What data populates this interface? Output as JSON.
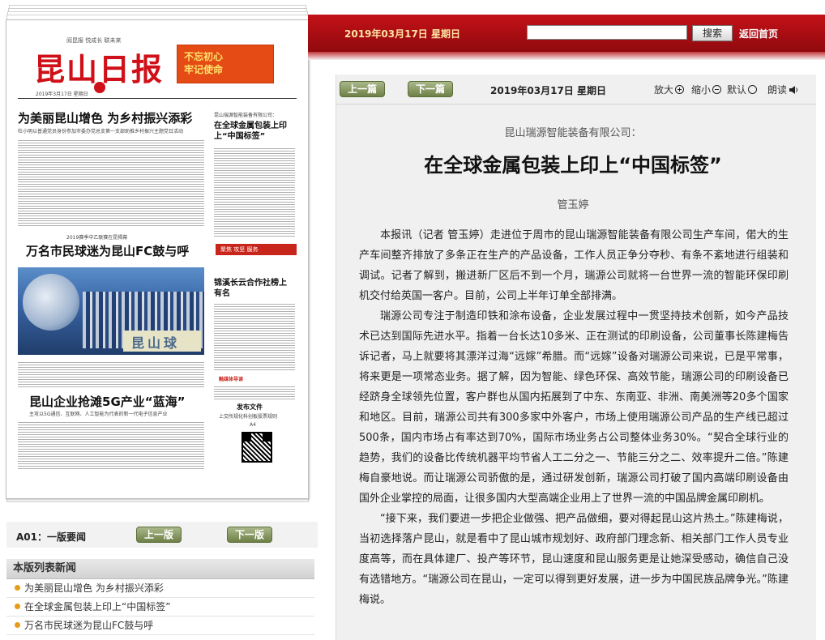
{
  "paper": {
    "mast_top": "阅昆报 悦成长 联未来",
    "name": "昆山日报",
    "mast_date": "2019年3月17日 星期日",
    "slogan": "不忘初心\n牢记使命",
    "lead_headline": "为美丽昆山增色 为乡村振兴添彩",
    "lead_sub": "杜小明以普通党员身份参加市委办党总支第一支部助推乡村振兴主题党日活动",
    "side_kicker": "昆山瑞源智能装备有限公司：",
    "side_headline": "在全球金属包装上印上“中国标签”",
    "football_kicker": "2019赛季中乙联赛在昆揭幕",
    "football_headline": "万名市民球迷为昆山FC鼓与呼",
    "coop_headline": "锦溪长云合作社榜上有名",
    "ad_text": "聚焦  攻坚  服务",
    "banner_text": "昆山球",
    "media_tag": "融媒体导读",
    "release_title": "发布文件",
    "release_sub": "上交所规化科创板股票规则",
    "release_page": "A4",
    "g5_headline": "昆山企业抢滩5G产业“蓝海”",
    "g5_sub": "主攻以5G通信、互联网、人工智能为代表的新一代电子信息产业"
  },
  "page_nav": {
    "label": "A01：一版要闻",
    "prev_label": "上一版",
    "next_label": "下一版"
  },
  "news_list": {
    "title": "本版列表新闻",
    "items": [
      "为美丽昆山增色 为乡村振兴添彩",
      "在全球金属包装上印上“中国标签”",
      "万名市民球迷为昆山FC鼓与呼"
    ]
  },
  "topbar": {
    "date": "2019年03月17日 星期日",
    "search_value": "",
    "search_button": "搜索",
    "home_link": "返回首页"
  },
  "article": {
    "prev_label": "上一篇",
    "next_label": "下一篇",
    "date": "2019年03月17日 星期日",
    "zoom_in": "放大",
    "zoom_out": "缩小",
    "default": "默认",
    "read_aloud": "朗读",
    "kicker": "昆山瑞源智能装备有限公司：",
    "title": "在全球金属包装上印上“中国标签”",
    "author": "管玉婷",
    "paragraphs": [
      "本报讯（记者 管玉婷）走进位于周市的昆山瑞源智能装备有限公司生产车间，偌大的生产车间整齐排放了多条正在生产的产品设备，工作人员正争分夺秒、有条不紊地进行组装和调试。记者了解到，搬进新厂区后不到一个月，瑞源公司就将一台世界一流的智能环保印刷机交付给英国一客户。目前，公司上半年订单全部排满。",
      "瑞源公司专注于制造印铁和涂布设备，企业发展过程中一贯坚持技术创新，如今产品技术已达到国际先进水平。指着一台长达10多米、正在测试的印刷设备，公司董事长陈建梅告诉记者，马上就要将其漂洋过海“远嫁”希腊。而“远嫁”设备对瑞源公司来说，已是平常事，将来更是一项常态业务。据了解，因为智能、绿色环保、高效节能，瑞源公司的印刷设备已经跻身全球领先位置，客户群也从国内拓展到了中东、东南亚、非洲、南美洲等20多个国家和地区。目前，瑞源公司共有300多家中外客户，市场上使用瑞源公司产品的生产线已超过500条，国内市场占有率达到70%，国际市场业务占公司整体业务30%。“契合全球行业的趋势，我们的设备比传统机器平均节省人工二分之一、节能三分之二、效率提升二倍。”陈建梅自豪地说。而让瑞源公司骄傲的是，通过研发创新，瑞源公司打破了国内高端印刷设备由国外企业掌控的局面，让很多国内大型高端企业用上了世界一流的中国品牌金属印刷机。",
      "“接下来，我们要进一步把企业做强、把产品做细，要对得起昆山这片热土。”陈建梅说，当初选择落户昆山，就是看中了昆山城市规划好、政府部门理念新、相关部门工作人员专业度高等，而在具体建厂、投产等环节，昆山速度和昆山服务更是让她深受感动，确信自己没有选错地方。“瑞源公司在昆山，一定可以得到更好发展，进一步为中国民族品牌争光。”陈建梅说。"
    ]
  },
  "colors": {
    "brand_red": "#c41118",
    "button_green": "#6e8047",
    "bullet_orange": "#e79c18"
  }
}
